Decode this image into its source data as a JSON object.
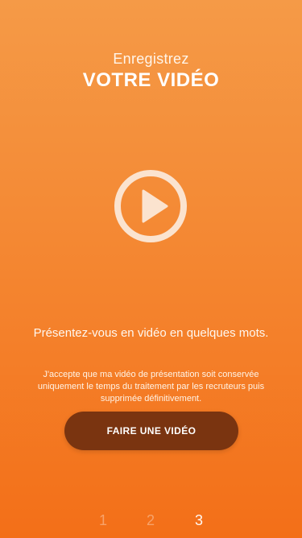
{
  "header": {
    "subtitle": "Enregistrez",
    "title": "VOTRE VIDÉO"
  },
  "play_icon": "play-circle-icon",
  "intro": {
    "lead": "Présentez-vous en vidéo en quelques mots.",
    "consent": "J'accepte que ma vidéo de présentation soit conservée uniquement le temps du traitement par les recruteurs puis supprimée définitivement."
  },
  "cta": {
    "label": "FAIRE UNE VIDÉO",
    "color": "#7a3410"
  },
  "steps": {
    "items": [
      "1",
      "2",
      "3"
    ],
    "active": 3
  },
  "colors": {
    "background_top": "#f59a47",
    "background_bottom": "#f36f18"
  }
}
